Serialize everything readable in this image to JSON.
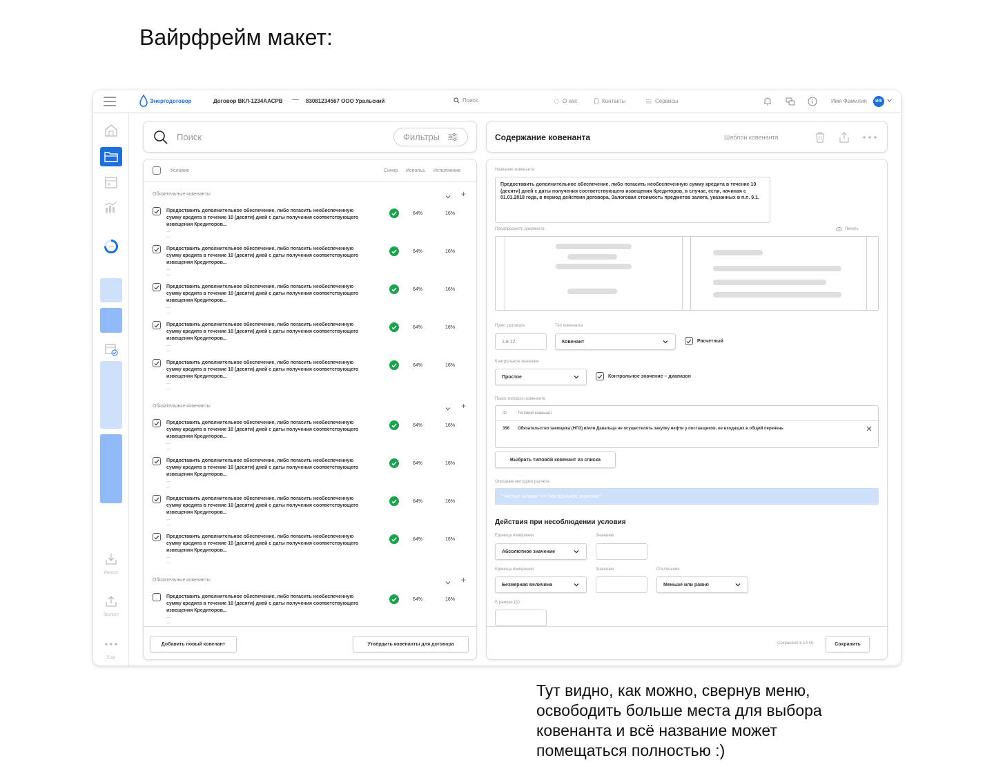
{
  "page": {
    "heading": "Вайрфрейм макет:",
    "caption": "Тут видно, как можно, свернув меню, освободить больше места для выбора ковенанта и всё название может помещаться полностью :)"
  },
  "topbar": {
    "logo_text": "Энергодоговор",
    "contract": "Договор ВКЛ-1234ААСРВ",
    "separator": "—",
    "company": "83081234567 ООО Уральский",
    "search_placeholder": "Поиск",
    "links": [
      "О нас",
      "Контакты",
      "Сервисы"
    ],
    "user_name": "Имя Фамилия",
    "avatar_initials": "ИФ"
  },
  "sidebar": {
    "progress_text": "75%",
    "labels": {
      "import": "Импорт",
      "export": "Экспорт",
      "more": "Ещё"
    }
  },
  "search_panel": {
    "placeholder": "Поиск",
    "filters_label": "Фильтры"
  },
  "list": {
    "columns": {
      "condition": "Условие",
      "sync": "Синхр.",
      "usage": "Использ.",
      "execution": "Исполнение"
    },
    "groups": [
      {
        "title": "Обязательные ковенанты",
        "rows": [
          {
            "checked": true,
            "text": "Предоставить дополнительное обеспечение, либо погасить необеспеченную сумму кредита в течение 10 (десяти) дней с даты получения соответствующего извещения Кредиторов...",
            "ellipsis": "...",
            "usage": "64%",
            "execution": "16%"
          },
          {
            "checked": true,
            "text": "Предоставить дополнительное обеспечение, либо погасить необеспеченную сумму кредита в течение 10 (десяти) дней с даты получения соответствующего извещения Кредиторов...",
            "ellipsis": "...",
            "usage": "64%",
            "execution": "16%"
          },
          {
            "checked": true,
            "text": "Предоставить дополнительное обеспечение, либо погасить необеспеченную сумму кредита в течение 10 (десяти) дней с даты получения соответствующего извещения Кредиторов...",
            "ellipsis": "...",
            "usage": "64%",
            "execution": "16%"
          },
          {
            "checked": true,
            "text": "Предоставить дополнительное обеспечение, либо погасить необеспеченную сумму кредита в течение 10 (десяти) дней с даты получения соответствующего извещения Кредиторов...",
            "ellipsis": "...",
            "usage": "64%",
            "execution": "16%"
          },
          {
            "checked": true,
            "text": "Предоставить дополнительное обеспечение, либо погасить необеспеченную сумму кредита в течение 10 (десяти) дней с даты получения соответствующего извещения Кредиторов...",
            "ellipsis": "...",
            "usage": "64%",
            "execution": "16%"
          }
        ]
      },
      {
        "title": "Обязательные ковенанты",
        "rows": [
          {
            "checked": true,
            "text": "Предоставить дополнительное обеспечение, либо погасить необеспеченную сумму кредита в течение 10 (десяти) дней с даты получения соответствующего извещения Кредиторов...",
            "ellipsis": "...",
            "usage": "64%",
            "execution": "16%"
          },
          {
            "checked": true,
            "text": "Предоставить дополнительное обеспечение, либо погасить необеспеченную сумму кредита в течение 10 (десяти) дней с даты получения соответствующего извещения Кредиторов...",
            "ellipsis": "...",
            "usage": "64%",
            "execution": "16%"
          },
          {
            "checked": true,
            "text": "Предоставить дополнительное обеспечение, либо погасить необеспеченную сумму кредита в течение 10 (десяти) дней с даты получения соответствующего извещения Кредиторов...",
            "ellipsis": "...",
            "usage": "64%",
            "execution": "16%"
          },
          {
            "checked": true,
            "text": "Предоставить дополнительное обеспечение, либо погасить необеспеченную сумму кредита в течение 10 (десяти) дней с даты получения соответствующего извещения Кредиторов...",
            "ellipsis": "...",
            "usage": "64%",
            "execution": "16%"
          }
        ]
      },
      {
        "title": "Обязательные ковенанты",
        "rows": [
          {
            "checked": false,
            "text": "Предоставить дополнительное обеспечение, либо погасить необеспеченную сумму кредита в течение 10 (десяти) дней с даты получения соответствующего извещения Кредиторов...",
            "ellipsis": "...",
            "usage": "64%",
            "execution": "16%"
          }
        ]
      }
    ],
    "add_button": "Добавить новый ковенант",
    "approve_button": "Утвердить ковенанты для договора"
  },
  "detail": {
    "title": "Содержание ковенанта",
    "template_label": "Шаблон ковенанта",
    "name_label": "Название ковенанта",
    "name_value": "Предоставить дополнительное обеспечение, либо погасить необеспеченную сумму кредита в течение 10 (десяти) дней с даты получения соответствующего извещения Кредиторов, в случае, если, начиная с 01.01.2018 года, в период действия договора, Залоговая стоимость предметов залога, указанных в п.п. 9.1.",
    "preview_label": "Предпросмотр документа",
    "print_label": "Печать",
    "clause_label": "Пункт договора",
    "clause_value": "1.8.12",
    "type_label": "Тип ковенанта",
    "type_value": "Ковенант",
    "calc_label": "Расчетный",
    "control_label": "Контрольное значение",
    "control_value": "Простое",
    "range_label": "Контрольное значение – диапазон",
    "typical_search_label": "Поиск типового ковенанта",
    "typical_cols": {
      "id": "ID",
      "name": "Типовой ковенант"
    },
    "typical_row": {
      "id": "356",
      "name": "Обязательство заемщика (НПЗ) и/или Давальца не осуществлять закупку нефти у поставщиков, не входящих в общий перечень"
    },
    "choose_button": "Выбрать типовой ковенант из списка",
    "method_label": "Описание методики расчета",
    "method_value": "\"Чистые активы\" >= \"контрольное значение\"",
    "actions_title": "Действия при несоблюдении условия",
    "unit_label_1": "Единица измерения",
    "unit_value_1": "Абсолютное значение",
    "value_label_1": "Значение",
    "unit_label_2": "Единица измерения",
    "unit_value_2": "Безмерная величина",
    "value_label_2": "Значение",
    "deviation_label": "Отклонение",
    "deviation_value": "Меньше или равно",
    "do_label": "В рамках ДО",
    "saved_text": "Сохранено в 12:55",
    "save_button": "Сохранить"
  },
  "colors": {
    "accent": "#1e6fd9",
    "success": "#1aa34a",
    "sidebar_light": "#cfe0fb",
    "sidebar_mid": "#8fbaf5"
  }
}
